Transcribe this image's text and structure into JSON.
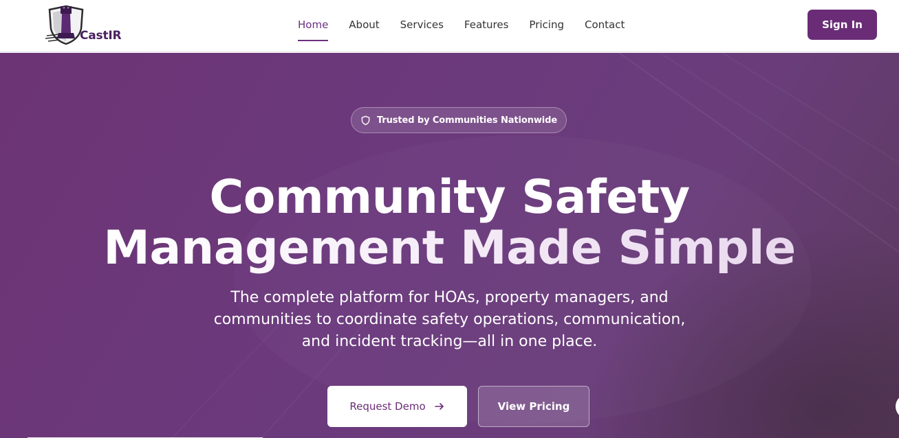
{
  "brand": {
    "name": "CastIR",
    "primary_color": "#6a2c77",
    "logo_icon": "rook-shield-icon"
  },
  "nav": {
    "items": [
      {
        "label": "Home",
        "active": true
      },
      {
        "label": "About",
        "active": false
      },
      {
        "label": "Services",
        "active": false
      },
      {
        "label": "Features",
        "active": false
      },
      {
        "label": "Pricing",
        "active": false
      },
      {
        "label": "Contact",
        "active": false
      }
    ],
    "signin_label": "Sign In"
  },
  "hero": {
    "badge": {
      "icon": "shield-icon",
      "text": "Trusted by Communities Nationwide"
    },
    "title_line1": "Community Safety",
    "title_line2": "Management Made Simple",
    "subtitle_line1": "The complete platform for HOAs, property managers, and",
    "subtitle_line2": "communities to coordinate safety operations, communication,",
    "subtitle_line3": "and incident tracking—all in one place.",
    "primary_button": {
      "label": "Request Demo",
      "icon": "arrow-right-icon"
    },
    "secondary_button": {
      "label": "View Pricing"
    }
  }
}
